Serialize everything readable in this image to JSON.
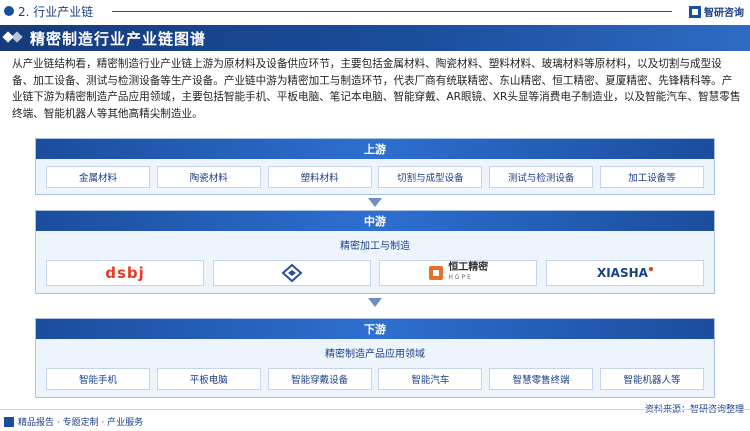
{
  "header": {
    "section_title": "2. 行业产业链",
    "brand": "智研咨询"
  },
  "title_bar": {
    "title": "精密制造行业产业链图谱"
  },
  "intro_text": "从产业链结构看，精密制造行业产业链上游为原材料及设备供应环节，主要包括金属材料、陶瓷材料、塑料材料、玻璃材料等原材料，以及切割与成型设备、加工设备、测试与检测设备等生产设备。产业链中游为精密加工与制造环节，代表厂商有统联精密、东山精密、恒工精密、夏厦精密、先锋精科等。产业链下游为精密制造产品应用领域，主要包括智能手机、平板电脑、笔记本电脑、智能穿戴、AR眼镜、XR头显等消费电子制造业，以及智能汽车、智慧零售终端、智能机器人等其他高精尖制造业。",
  "upstream": {
    "header": "上游",
    "items": [
      "金属材料",
      "陶瓷材料",
      "塑料材料",
      "切割与成型设备",
      "测试与检测设备",
      "加工设备等"
    ]
  },
  "midstream": {
    "header": "中游",
    "subtitle": "精密加工与制造",
    "logos": [
      {
        "name": "dsbj",
        "color": "#e23b2a"
      },
      {
        "name": "",
        "color": "#2a4f9c"
      },
      {
        "name": "恒工精密",
        "sub": "HGPE",
        "color": "#333333"
      },
      {
        "name": "XIASHA",
        "color": "#1a3f86"
      }
    ]
  },
  "downstream": {
    "header": "下游",
    "subtitle": "精密制造产品应用领域",
    "items": [
      "智能手机",
      "平板电脑",
      "智能穿戴设备",
      "智能汽车",
      "智慧零售终端",
      "智能机器人等"
    ]
  },
  "footer": {
    "left_text": "精品报告 · 专题定制 · 产业服务",
    "source": "资料来源：智研咨询整理"
  },
  "colors": {
    "primary": "#1a4fa0",
    "accent": "#2e6fd0",
    "panel_bg": "#eef4fc"
  }
}
